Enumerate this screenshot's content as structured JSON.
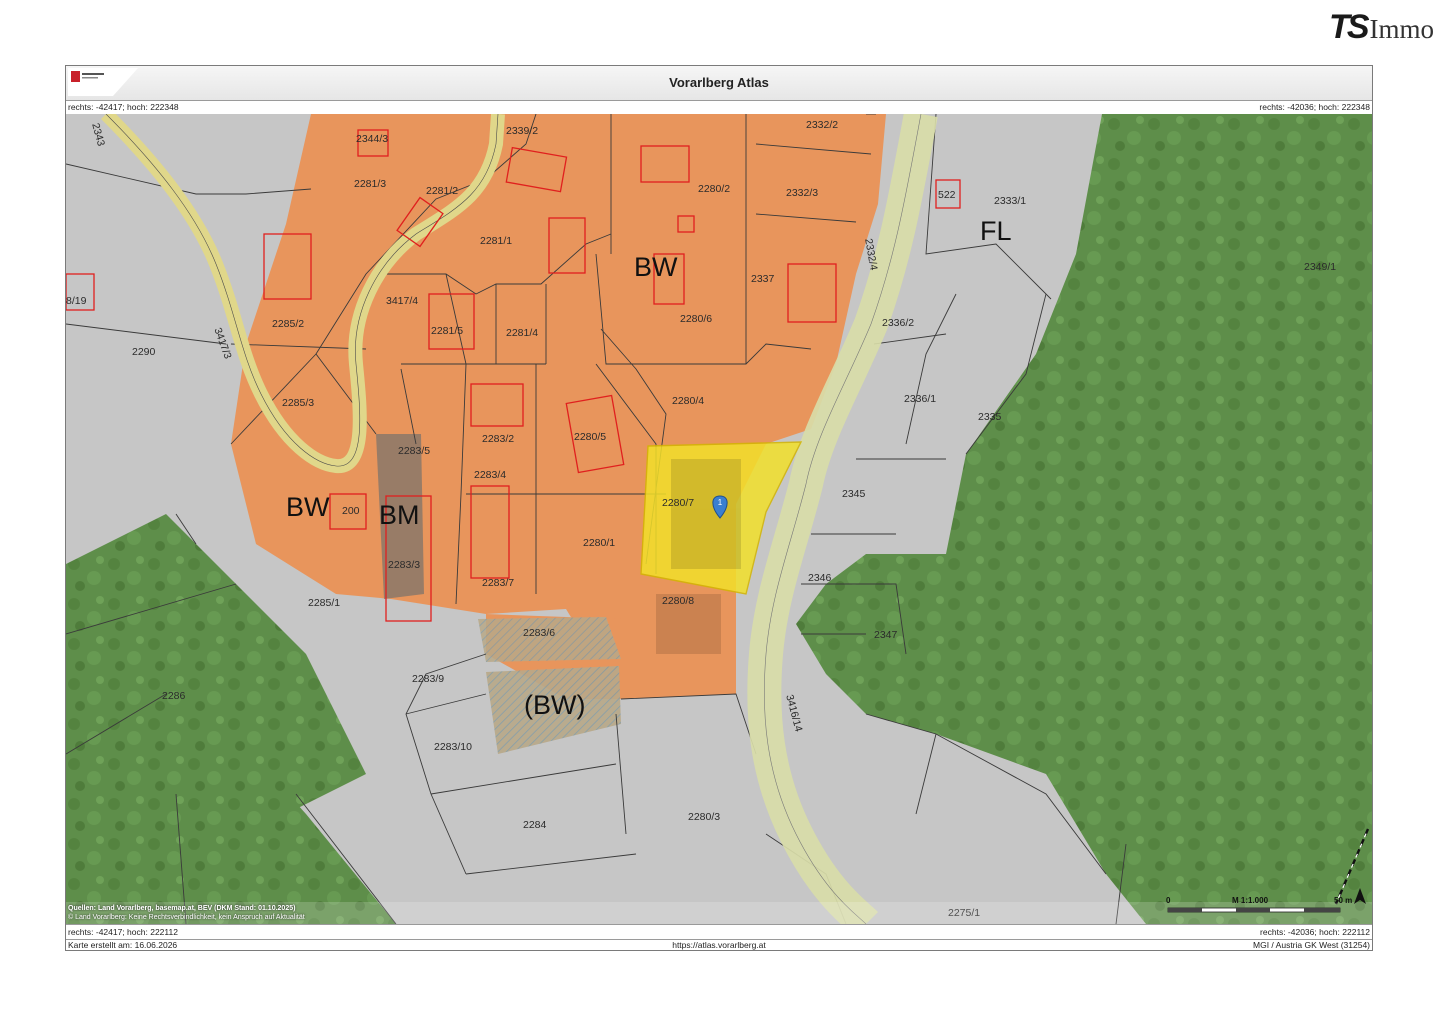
{
  "logo": {
    "ts": "TS",
    "immo": "Immo"
  },
  "header": {
    "title": "Vorarlberg Atlas"
  },
  "coords": {
    "top_left": "rechts: -42417; hoch: 222348",
    "top_right": "rechts: -42036; hoch: 222348",
    "bottom_left": "rechts: -42417; hoch: 222112",
    "bottom_right": "rechts: -42036; hoch: 222112"
  },
  "footer": {
    "created": "Karte erstellt am: 16.06.2026",
    "url": "https://atlas.vorarlberg.at",
    "projection": "MGI / Austria GK West (31254)"
  },
  "sources": {
    "line1": "Quellen: Land Vorarlberg, basemap.at, BEV (DKM Stand: 01.10.2025)",
    "line2": "© Land Vorarlberg: Keine Rechtsverbindlichkeit, kein Anspruch auf Aktualität"
  },
  "scale": {
    "zero": "0",
    "ratio": "M 1:1.000",
    "end": "50 m",
    "north": "N"
  },
  "marker": {
    "label": "1"
  },
  "zones": {
    "bw_top": "BW",
    "bw_left": "BW",
    "bm": "BM",
    "bw_paren": "(BW)",
    "fl": "FL"
  },
  "plots": {
    "p2344_3": "2344/3",
    "p2339_2": "2339/2",
    "p2332_2": "2332/2",
    "p2281_3": "2281/3",
    "p2281_2": "2281/2",
    "p2280_2": "2280/2",
    "p2332_3": "2332/3",
    "p2522": "522",
    "p2333_1": "2333/1",
    "p2281_1": "2281/1",
    "p2332_4": "2332/4",
    "p2337": "2337",
    "p2349_1": "2349/1",
    "p2341_4": "3417/4",
    "p2281_5": "2281/5",
    "p2281_4": "2281/4",
    "p2280_6": "2280/6",
    "p2285_2": "2285/2",
    "p2336_2": "2336/2",
    "p3417_3": "3417/3",
    "p2290": "2290",
    "p2280_4": "2280/4",
    "p2336_1": "2336/1",
    "p2335": "2335",
    "p2285_3": "2285/3",
    "p2283_2": "2283/2",
    "p2280_5": "2280/5",
    "p2283_5": "2283/5",
    "p2283_4": "2283/4",
    "p2280_7": "2280/7",
    "p2345": "2345",
    "p200": "200",
    "p2280_1": "2280/1",
    "p2283_3": "2283/3",
    "p2283_7": "2283/7",
    "p2346": "2346",
    "p2285_1": "2285/1",
    "p2280_8": "2280/8",
    "p2283_6": "2283/6",
    "p2347": "2347",
    "p2283_9": "2283/9",
    "p3416_14": "3416/14",
    "p2286": "2286",
    "p2283_10": "2283/10",
    "p2284": "2284",
    "p2280_3": "2280/3",
    "p2275_1": "2275/1",
    "p8_19": "8/19",
    "p2343": "2343"
  },
  "colors": {
    "building_zone": "#e8955c",
    "forest": "#5e8e4a",
    "grey_parcel": "#c9c9c9",
    "road": "#d8dca8",
    "selected_parcel": "#f2e02a",
    "building_outline": "#e0201e",
    "mixed_zone": "#8a7868",
    "marker": "#3a7fd0"
  }
}
